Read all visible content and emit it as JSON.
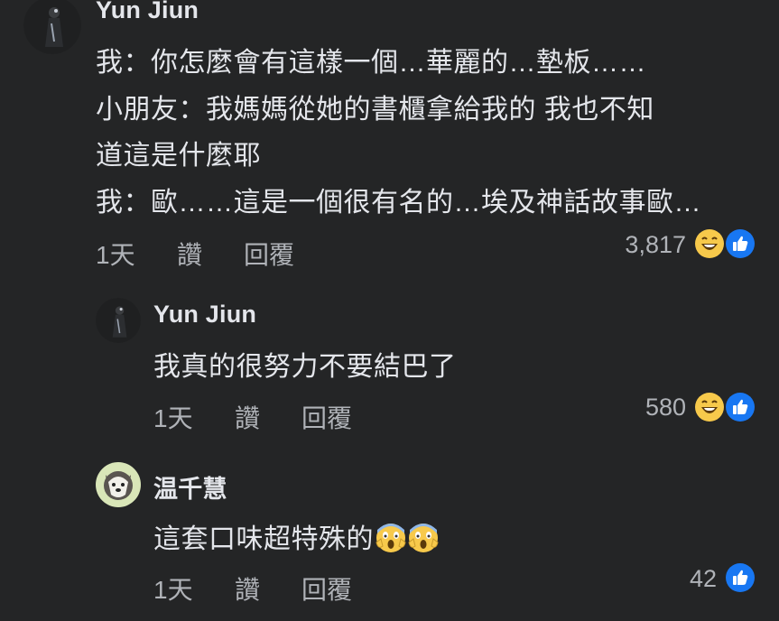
{
  "comments": [
    {
      "author": "Yun Jiun",
      "lines": [
        "我：你怎麼會有這樣一個…華麗的…墊板……",
        "小朋友：我媽媽從她的書櫃拿給我的 我也不知",
        "道這是什麼耶",
        "我：歐……這是一個很有名的…埃及神話故事歐…"
      ],
      "time": "1天",
      "like_label": "讚",
      "reply_label": "回覆",
      "reaction_count": "3,817",
      "reactions": [
        "laugh-emoji-icon",
        "like-icon"
      ]
    },
    {
      "author": "Yun Jiun",
      "lines": [
        "我真的很努力不要結巴了"
      ],
      "time": "1天",
      "like_label": "讚",
      "reply_label": "回覆",
      "reaction_count": "580",
      "reactions": [
        "laugh-emoji-icon",
        "like-icon"
      ]
    },
    {
      "author": "温千慧",
      "lines": [
        "這套口味超特殊的"
      ],
      "inline_emojis": [
        "scream-emoji-icon",
        "scream-emoji-icon"
      ],
      "time": "1天",
      "like_label": "讚",
      "reply_label": "回覆",
      "reaction_count": "42",
      "reactions": [
        "like-icon"
      ]
    }
  ],
  "colors": {
    "background": "#242526",
    "primary_text": "#e4e6eb",
    "secondary_text": "#b0b3b8",
    "like_blue": "#1877f2",
    "laugh_yellow": "#f7c94b"
  }
}
